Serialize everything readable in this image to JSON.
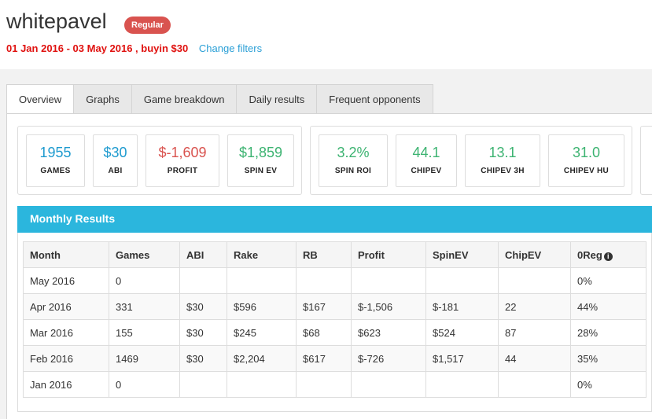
{
  "header": {
    "player_name": "whitepavel",
    "badge": "Regular",
    "date_range": "01 Jan 2016 - 03 May 2016 , buyin $30",
    "change_filters": "Change filters"
  },
  "tabs": [
    {
      "label": "Overview",
      "active": true
    },
    {
      "label": "Graphs"
    },
    {
      "label": "Game breakdown"
    },
    {
      "label": "Daily results"
    },
    {
      "label": "Frequent opponents"
    }
  ],
  "stats": {
    "games": {
      "value": "1955",
      "label": "GAMES"
    },
    "abi": {
      "value": "$30",
      "label": "ABI"
    },
    "profit": {
      "value": "$-1,609",
      "label": "PROFIT"
    },
    "spin_ev": {
      "value": "$1,859",
      "label": "SPIN EV"
    },
    "spin_roi": {
      "value": "3.2%",
      "label": "SPIN ROI"
    },
    "chipev": {
      "value": "44.1",
      "label": "CHIPEV"
    },
    "chipev_3h": {
      "value": "13.1",
      "label": "CHIPEV 3H"
    },
    "chipev_hu": {
      "value": "31.0",
      "label": "CHIPEV HU"
    }
  },
  "colors": {
    "blue": "#1f9bcf",
    "red": "#d9534f",
    "green": "#3cb371",
    "header_bar": "#2bb6dd"
  },
  "monthly": {
    "title": "Monthly Results",
    "columns": [
      "Month",
      "Games",
      "ABI",
      "Rake",
      "RB",
      "Profit",
      "SpinEV",
      "ChipEV",
      "0Reg"
    ],
    "info_icon": "info-icon",
    "rows": [
      [
        "May 2016",
        "0",
        "",
        "",
        "",
        "",
        "",
        "",
        "0%"
      ],
      [
        "Apr 2016",
        "331",
        "$30",
        "$596",
        "$167",
        "$-1,506",
        "$-181",
        "22",
        "44%"
      ],
      [
        "Mar 2016",
        "155",
        "$30",
        "$245",
        "$68",
        "$623",
        "$524",
        "87",
        "28%"
      ],
      [
        "Feb 2016",
        "1469",
        "$30",
        "$2,204",
        "$617",
        "$-726",
        "$1,517",
        "44",
        "35%"
      ],
      [
        "Jan 2016",
        "0",
        "",
        "",
        "",
        "",
        "",
        "",
        "0%"
      ]
    ]
  }
}
